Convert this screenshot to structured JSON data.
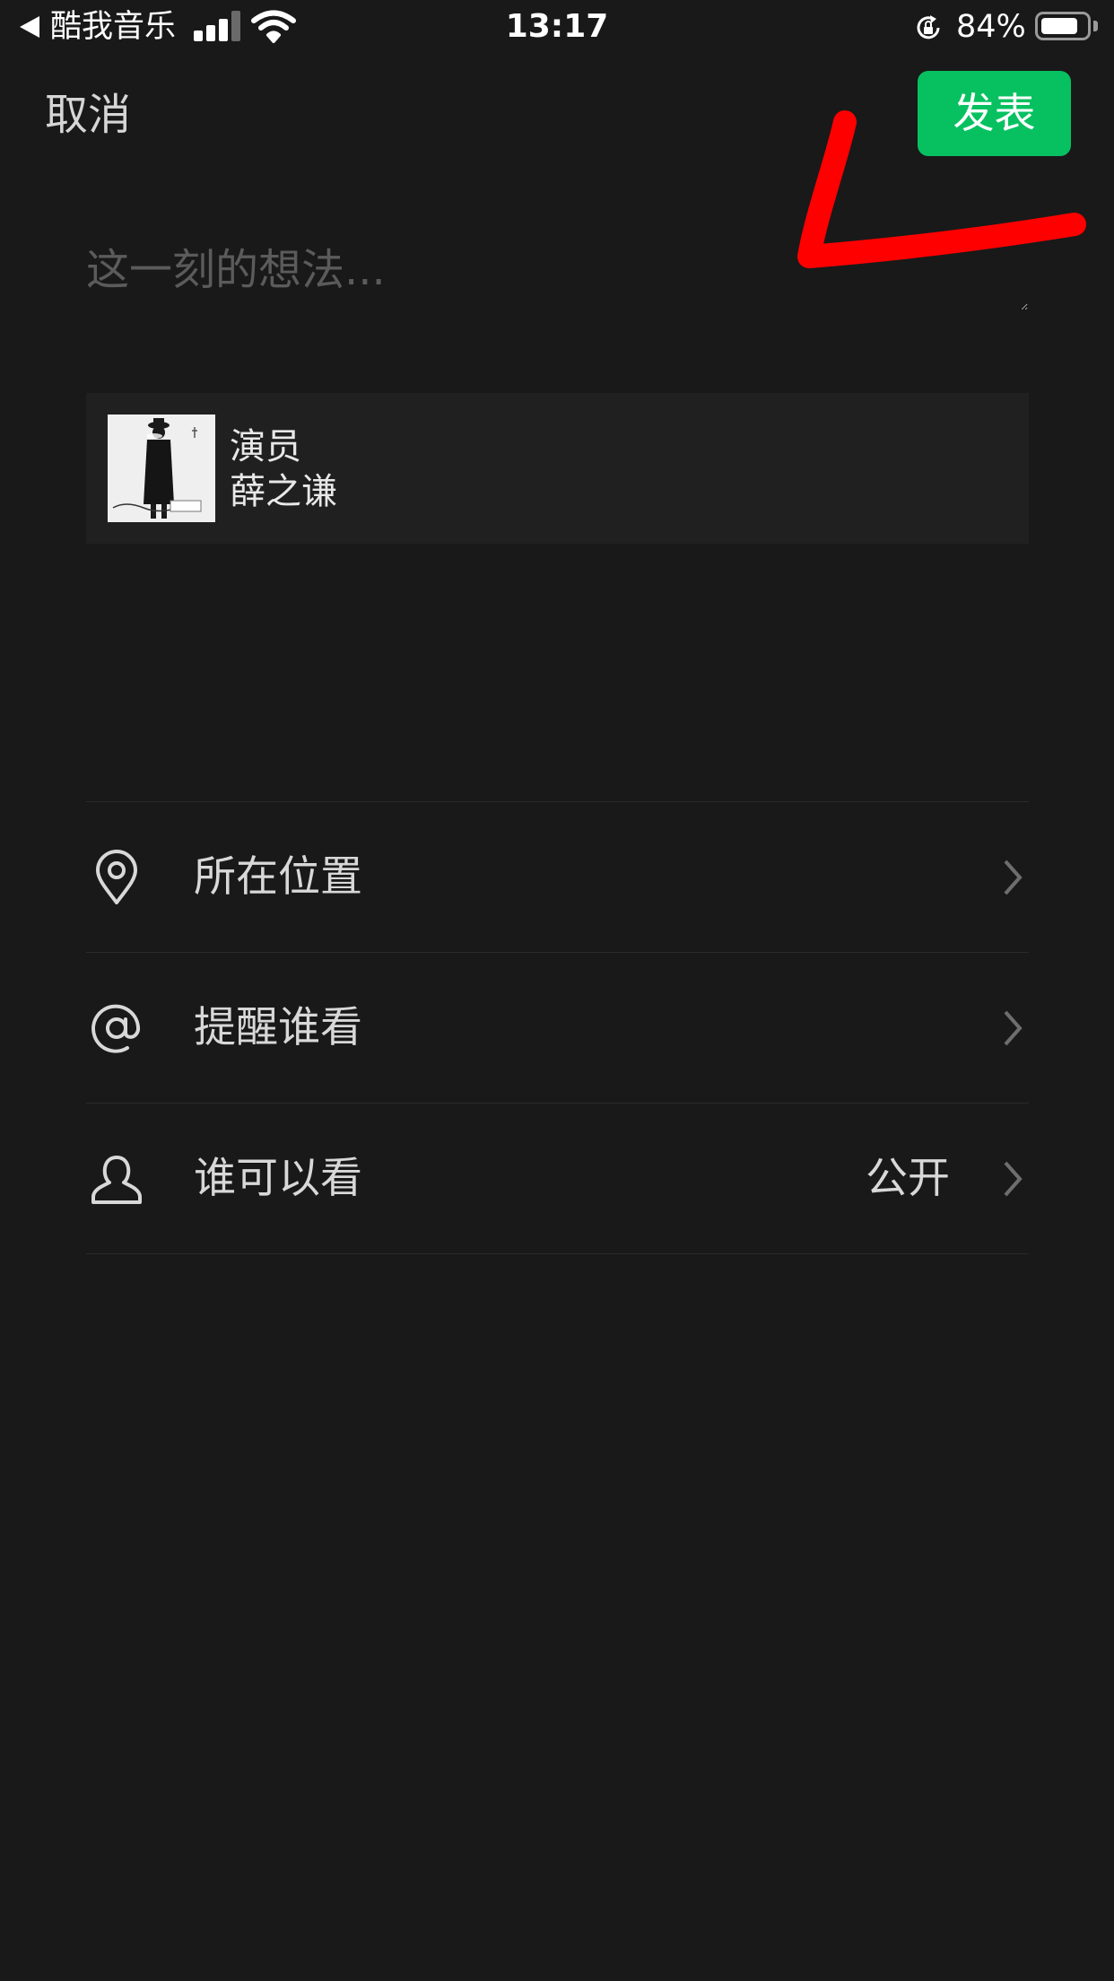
{
  "status_bar": {
    "back_app": "酷我音乐",
    "time": "13:17",
    "battery_percent": "84%",
    "battery_level": 0.84,
    "signal_bars": 3,
    "icons": [
      "back-arrow-icon",
      "signal-icon",
      "wifi-icon",
      "rotation-lock-icon",
      "battery-icon"
    ]
  },
  "nav": {
    "cancel_label": "取消",
    "publish_label": "发表",
    "publish_color": "#07c160"
  },
  "compose": {
    "placeholder": "这一刻的想法...",
    "value": ""
  },
  "music_card": {
    "title": "演员",
    "artist": "薛之谦"
  },
  "options": [
    {
      "label": "所在位置",
      "icon": "location-pin-icon",
      "value": ""
    },
    {
      "label": "提醒谁看",
      "icon": "at-sign-icon",
      "value": ""
    },
    {
      "label": "谁可以看",
      "icon": "person-icon",
      "value": "公开"
    }
  ],
  "annotation": {
    "type": "hand-drawn red arrow pointing to publish button",
    "color": "#ff0000"
  },
  "theme": {
    "background": "#191919",
    "card": "#202020",
    "divider": "#2a2a2a",
    "placeholder": "#5b5b5b"
  }
}
